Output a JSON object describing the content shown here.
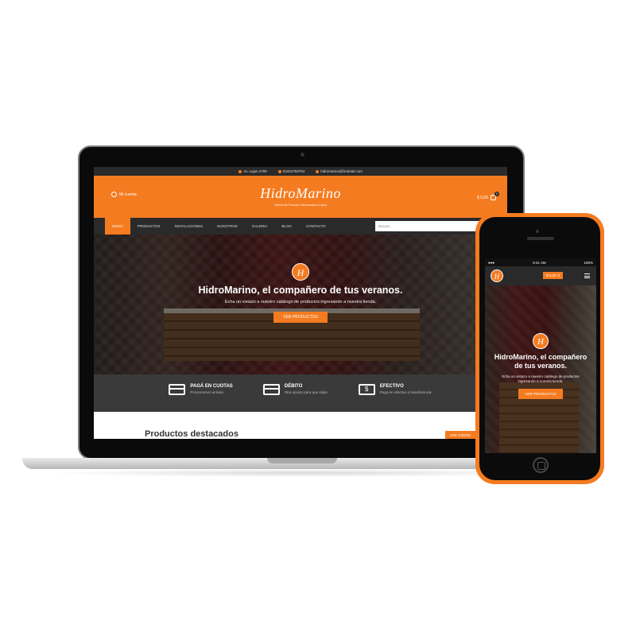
{
  "laptop": {
    "topbar": {
      "address": "Av. Lujan 2799",
      "phone": "03424750754",
      "email": "hidromarino@hotmail.com"
    },
    "header": {
      "account_label": "Mi cuenta",
      "logo": "HidroMarino",
      "tagline": "Fábrica de Piscinas, Hidromasajes & Spas",
      "cart_total": "$ 0,00",
      "cart_count": "0"
    },
    "nav": {
      "items": [
        "INICIO",
        "PRODUCTOS",
        "INSTALACIONES",
        "NOSOTROS",
        "GALERIA",
        "BLOG",
        "CONTACTO"
      ],
      "search_placeholder": "Buscar..."
    },
    "hero": {
      "badge": "H",
      "title": "HidroMarino, el compañero de tus veranos.",
      "subtitle": "Echa un vistazo a nuestro catálogo de productos ingresando a nuestra tienda.",
      "button": "VER PRODUCTOS"
    },
    "features": [
      {
        "title": "PAGÁ EN CUOTAS",
        "desc": "Promociones activas.",
        "icon": "credit-card-icon"
      },
      {
        "title": "DÉBITO",
        "desc": "Otra opción para que elijas.",
        "icon": "debit-card-icon"
      },
      {
        "title": "EFECTIVO",
        "desc": "Pagá en efectivo o transferencia.",
        "icon": "cash-icon"
      }
    ],
    "products": {
      "title": "Productos destacados",
      "view_all": "VER TODOS"
    }
  },
  "phone": {
    "status": {
      "time": "9:41 AM",
      "battery": "100%"
    },
    "header": {
      "badge": "H",
      "cart_total": "$ 0,00",
      "cart_count": "0"
    },
    "hero": {
      "badge": "H",
      "title": "HidroMarino, el compañero de tus veranos.",
      "subtitle": "Echa un vistazo a nuestro catálogo de productos ingresando a nuestra tienda.",
      "button": "VER PRODUCTOS"
    }
  },
  "colors": {
    "accent": "#f47b20",
    "dark": "#2a2a2a",
    "phone_body": "#f47b20"
  }
}
